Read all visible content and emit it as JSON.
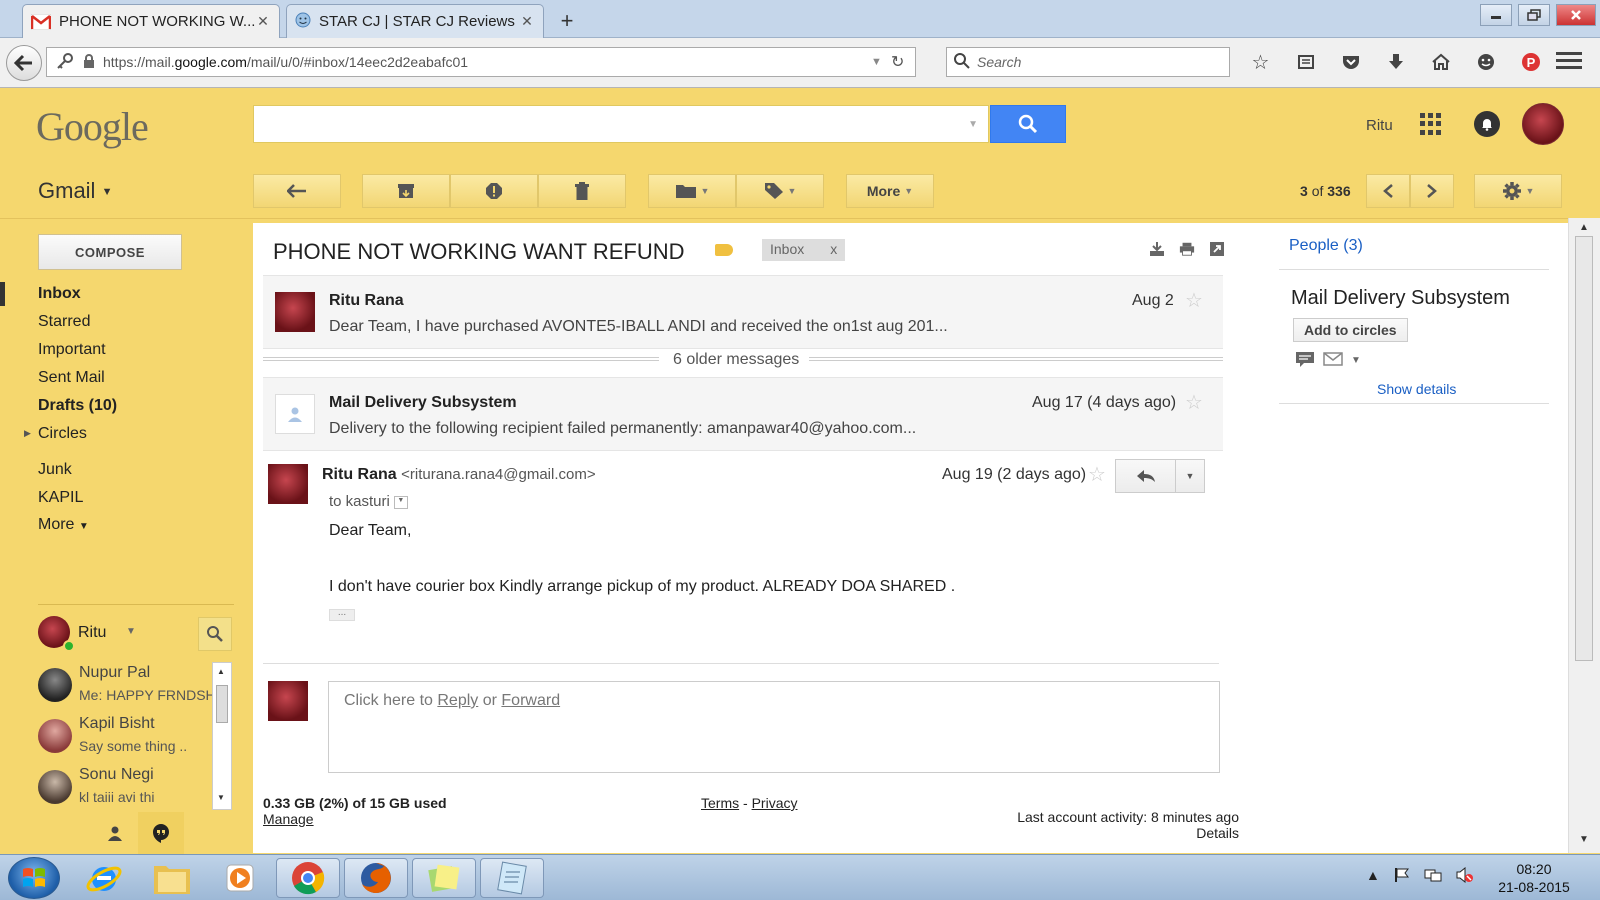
{
  "browser": {
    "tabs": [
      {
        "label": "PHONE NOT WORKING W...",
        "close": "✕"
      },
      {
        "label": "STAR CJ | STAR CJ Reviews ...",
        "close": "✕"
      }
    ],
    "new_tab": "+",
    "url_prefix": "https://mail.",
    "url_domain": "google.com",
    "url_path": "/mail/u/0/#inbox/14eec2d2eabafc01",
    "search_placeholder": "Search"
  },
  "header": {
    "logo": "Google",
    "user_name": "Ritu"
  },
  "toolbar": {
    "app_label": "Gmail",
    "more_label": "More",
    "pager_current": "3",
    "pager_of": "of",
    "pager_total": "336"
  },
  "sidebar": {
    "compose": "COMPOSE",
    "items": [
      {
        "label": "Inbox",
        "bold": true
      },
      {
        "label": "Starred"
      },
      {
        "label": "Important"
      },
      {
        "label": "Sent Mail"
      },
      {
        "label": "Drafts (10)",
        "bold": true
      },
      {
        "label": "Circles"
      },
      {
        "label": "Junk"
      },
      {
        "label": "KAPIL"
      },
      {
        "label": "More"
      }
    ],
    "chat_user": "Ritu",
    "contacts": [
      {
        "name": "Nupur Pal",
        "status": "Me: HAPPY FRNDSHI"
      },
      {
        "name": "Kapil Bisht",
        "status": "Say some thing .."
      },
      {
        "name": "Sonu Negi",
        "status": "kl taiii avi thi"
      }
    ]
  },
  "thread": {
    "subject": "PHONE NOT WORKING WANT REFUND",
    "chip_label": "Inbox",
    "chip_close": "x",
    "messages": [
      {
        "sender": "Ritu Rana",
        "snippet": "Dear Team, I have purchased AVONTE5-IBALL ANDI and received the on1st aug 201...",
        "date": "Aug 2"
      },
      {
        "older_label": "6 older messages"
      },
      {
        "sender": "Mail Delivery Subsystem",
        "snippet": "Delivery to the following recipient failed permanently: amanpawar40@yahoo.com...",
        "date": "Aug 17 (4 days ago)"
      },
      {
        "sender": "Ritu Rana",
        "email": "<riturana.rana4@gmail.com>",
        "date": "Aug 19 (2 days ago)",
        "to": "to kasturi",
        "body_line1": "Dear Team,",
        "body_line2": "I don't have courier box  Kindly arrange pickup of my product. ALREADY DOA SHARED ."
      }
    ],
    "reply_prefix": "Click here to ",
    "reply_link": "Reply",
    "reply_or": " or ",
    "forward_link": "Forward"
  },
  "footer": {
    "storage": "0.33 GB (2%) of 15 GB used",
    "manage": "Manage",
    "terms": "Terms",
    "dash": " - ",
    "privacy": "Privacy",
    "activity": "Last account activity: 8 minutes ago",
    "details": "Details"
  },
  "people": {
    "title": "People (3)",
    "name": "Mail Delivery Subsystem",
    "add_circles": "Add to circles",
    "show_details": "Show details"
  },
  "taskbar": {
    "time": "08:20",
    "date": "21-08-2015"
  },
  "colors": {
    "gmail_theme": "#f5d76e",
    "search_button": "#4285f4",
    "link": "#1a5fc4"
  }
}
